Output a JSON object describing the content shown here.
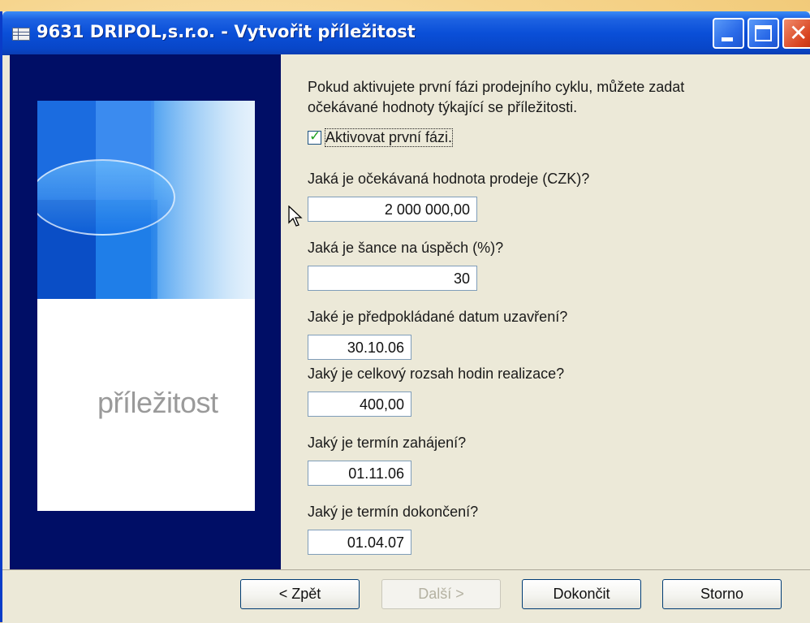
{
  "window": {
    "title": "9631 DRIPOL,s.r.o. - Vytvořit příležitost"
  },
  "side_panel": {
    "image_word": "příležitost"
  },
  "form": {
    "intro_line1": "Pokud aktivujete první fázi prodejního cyklu, můžete zadat",
    "intro_line2": "očekávané hodnoty týkající se příležitosti.",
    "activate_label": "Aktivovat první fázi.",
    "activate_checked": true,
    "fields": [
      {
        "label": "Jaká je očekávaná hodnota prodeje (CZK)?",
        "value": "2 000 000,00"
      },
      {
        "label": "Jaká je šance na úspěch (%)?",
        "value": "30"
      },
      {
        "label": "Jaké je předpokládané datum uzavření?",
        "value": "30.10.06"
      },
      {
        "label": "Jaký je celkový rozsah hodin realizace?",
        "value": "400,00"
      },
      {
        "label": "Jaký je termín zahájení?",
        "value": "01.11.06"
      },
      {
        "label": "Jaký je termín dokončení?",
        "value": "01.04.07"
      }
    ]
  },
  "buttons": {
    "back": "< Zpět",
    "next": "Další >",
    "finish": "Dokončit",
    "cancel": "Storno"
  },
  "icons": {
    "app": "table-icon",
    "minimize": "minimize-icon",
    "maximize": "maximize-icon",
    "close": "close-icon",
    "check": "checkmark-icon",
    "cursor": "mouse-pointer-icon"
  }
}
